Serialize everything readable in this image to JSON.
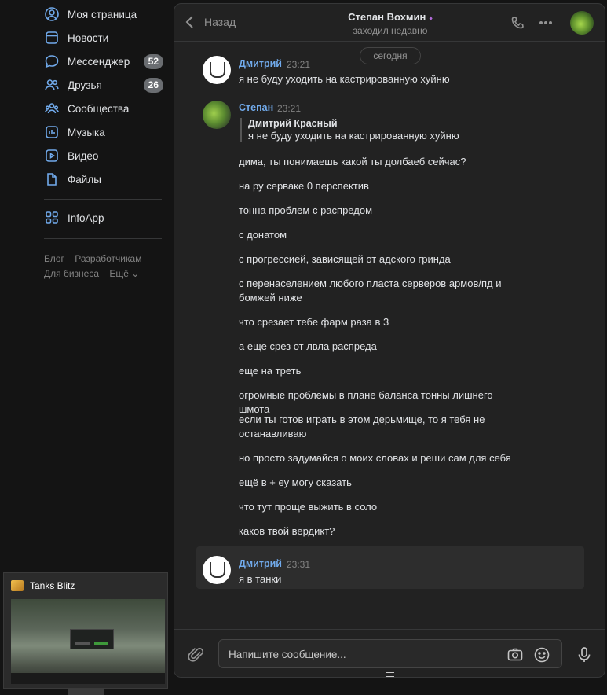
{
  "sidebar": {
    "items": [
      {
        "label": "Моя страница",
        "icon": "user-circle-icon"
      },
      {
        "label": "Новости",
        "icon": "news-icon"
      },
      {
        "label": "Мессенджер",
        "icon": "message-icon",
        "counter": "52"
      },
      {
        "label": "Друзья",
        "icon": "friends-icon",
        "counter": "26"
      },
      {
        "label": "Сообщества",
        "icon": "groups-icon"
      },
      {
        "label": "Музыка",
        "icon": "music-icon"
      },
      {
        "label": "Видео",
        "icon": "video-icon"
      },
      {
        "label": "Файлы",
        "icon": "file-icon"
      }
    ],
    "app": {
      "label": "InfoApp",
      "icon": "apps-grid-icon"
    },
    "footer": {
      "blog": "Блог",
      "developers": "Разработчикам",
      "business": "Для бизнеса",
      "more": "Ещё ⌄"
    }
  },
  "taskbar_preview": {
    "title": "Tanks Blitz",
    "icon": "tanks-blitz-app-icon"
  },
  "chat": {
    "back_label": "Назад",
    "peer_name": "Степан Вохмин",
    "peer_status": "заходил недавно",
    "date_separator": "сегодня",
    "messages": [
      {
        "author": "Дмитрий",
        "time": "23:21",
        "text": "я не буду уходить на кастрированную хуйню"
      },
      {
        "author": "Степан",
        "time": "23:21",
        "reply": {
          "author": "Дмитрий Красный",
          "text": "я не буду уходить на кастрированную хуйню"
        },
        "lines": [
          "дима, ты понимаешь какой ты долбаеб сейчас?",
          "на ру серваке 0 перспектив",
          "тонна проблем с распредом",
          "с донатом",
          "с прогрессией, зависящей от адского гринда",
          "с перенаселением любого пласта серверов армов/пд и бомжей ниже",
          "что срезает тебе фарм раза в 3",
          "а еще срез от лвла распреда",
          "еще на треть",
          "огромные проблемы в плане баланса тонны лишнего шмота",
          "если ты готов играть в этом дерьмище, то я тебя не останавливаю",
          "но просто задумайся о моих словах и реши сам для себя",
          "ещё в + еу могу сказать",
          "что тут проще выжить в соло",
          "каков твой вердикт?"
        ]
      },
      {
        "author": "Дмитрий",
        "time": "23:31",
        "text": "я в танки"
      }
    ],
    "composer": {
      "placeholder": "Напишите сообщение..."
    }
  },
  "colors": {
    "accent": "#71aaeb",
    "background": "#141414",
    "panel": "#222222",
    "text": "#e1e3e6",
    "muted": "#939393"
  }
}
